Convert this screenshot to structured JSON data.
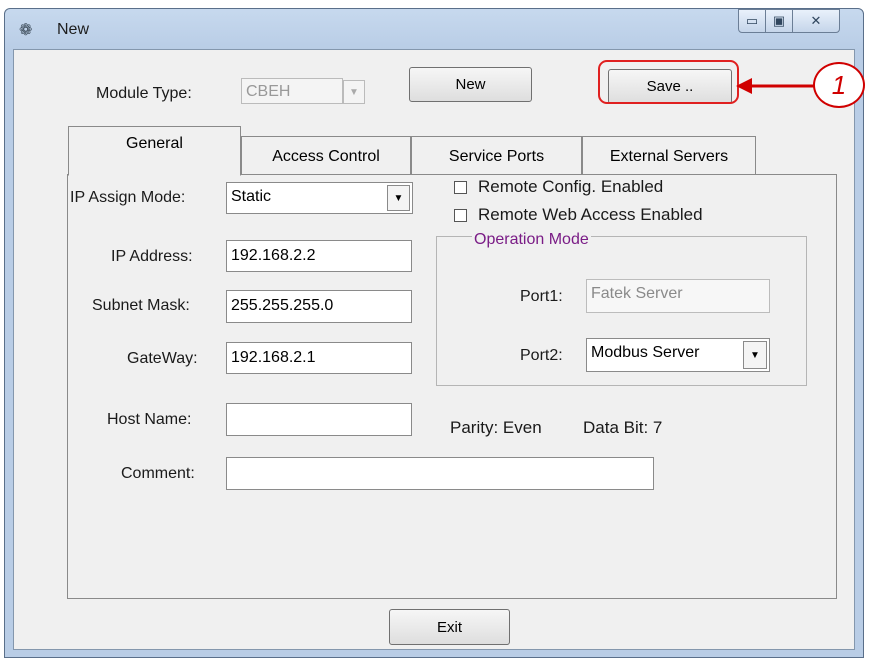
{
  "window": {
    "title": "New",
    "app_icon": "ringed-planet-icon"
  },
  "header": {
    "module_type_label": "Module Type:",
    "module_type_value": "CBEH",
    "new_button": "New",
    "save_button": "Save .."
  },
  "tabs": [
    {
      "label": "General",
      "active": true
    },
    {
      "label": "Access Control",
      "active": false
    },
    {
      "label": "Service Ports",
      "active": false
    },
    {
      "label": "External Servers",
      "active": false
    }
  ],
  "general": {
    "ip_assign_mode_label": "IP Assign Mode:",
    "ip_assign_mode_value": "Static",
    "ip_address_label": "IP Address:",
    "ip_address_value": "192.168.2.2",
    "subnet_mask_label": "Subnet Mask:",
    "subnet_mask_value": "255.255.255.0",
    "gateway_label": "GateWay:",
    "gateway_value": "192.168.2.1",
    "host_name_label": "Host Name:",
    "host_name_value": "",
    "comment_label": "Comment:",
    "comment_value": "",
    "remote_config_label": "Remote Config. Enabled",
    "remote_config_checked": false,
    "remote_web_label": "Remote Web Access Enabled",
    "remote_web_checked": false,
    "operation_mode_title": "Operation Mode",
    "port1_label": "Port1:",
    "port1_value": "Fatek Server",
    "port2_label": "Port2:",
    "port2_value": "Modbus Server",
    "parity_text": "Parity: Even",
    "databit_text": "Data Bit: 7"
  },
  "footer": {
    "exit_button": "Exit"
  },
  "annotation": {
    "callout_number": "1",
    "highlight_color": "#e02020"
  }
}
